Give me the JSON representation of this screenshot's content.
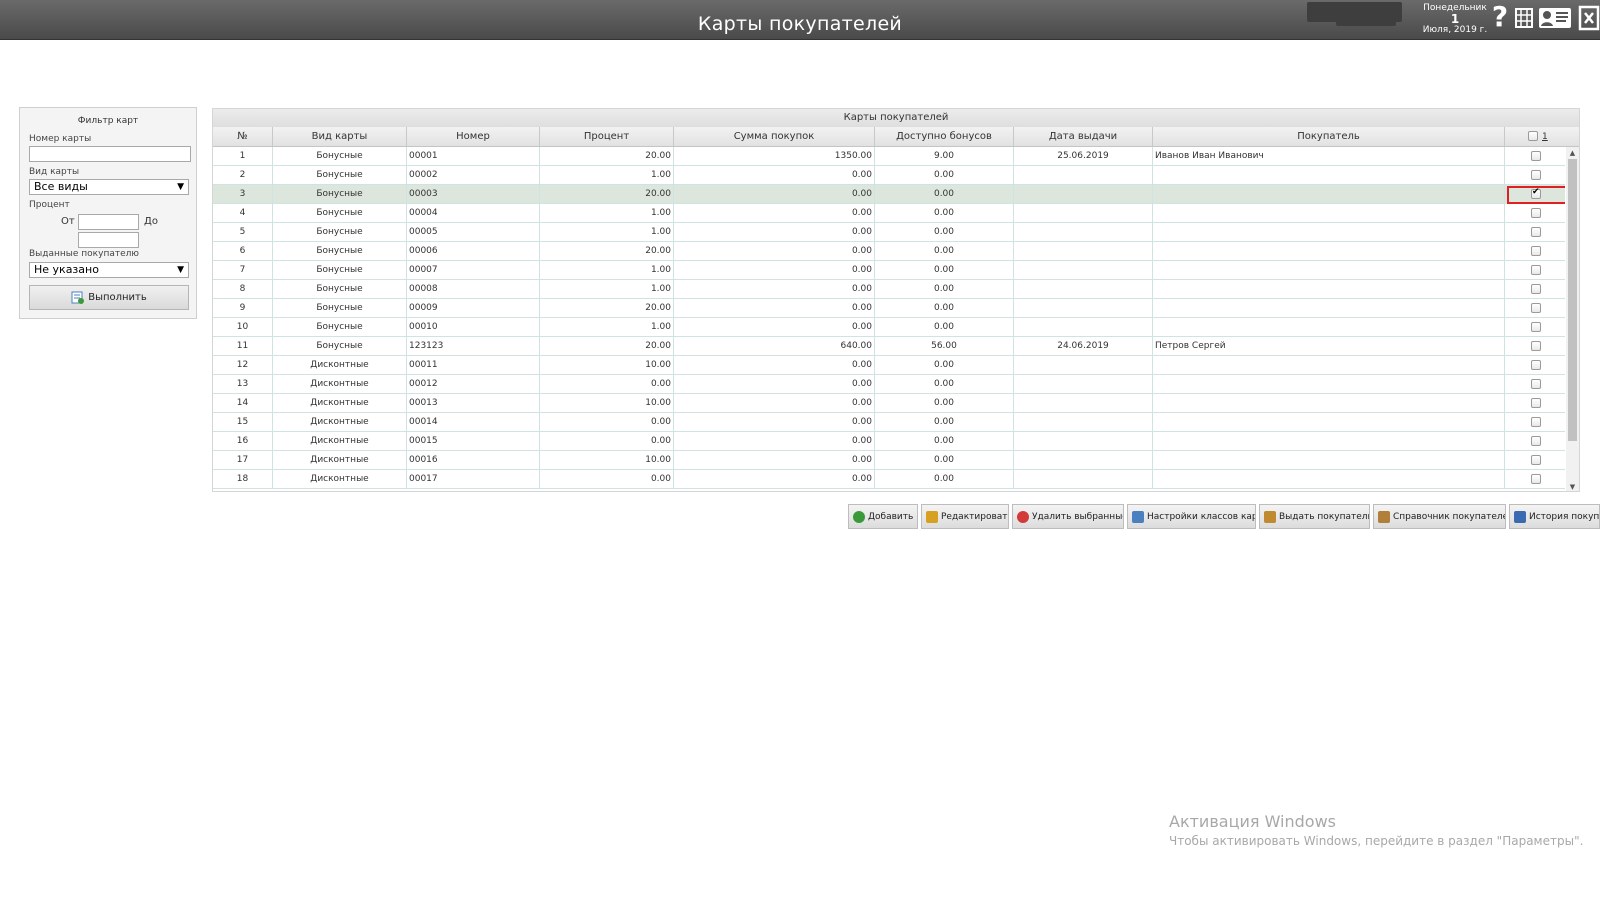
{
  "header": {
    "title": "Карты покупателей",
    "date": {
      "weekday": "Понедельник",
      "day": "1",
      "month_year": "Июля, 2019 г."
    },
    "help_glyph": "?",
    "icons": [
      "help-icon",
      "grid-icon",
      "card-icon",
      "exit-icon"
    ]
  },
  "filter": {
    "title": "Фильтр карт",
    "card_number_label": "Номер карты",
    "card_number_value": "",
    "card_type_label": "Вид карты",
    "card_type_value": "Все виды",
    "percent_label": "Процент",
    "from_label": "От",
    "to_label": "До",
    "issued_label": "Выданные покупателю",
    "issued_value": "Не указано",
    "run_button": "Выполнить"
  },
  "grid": {
    "caption": "Карты покупателей",
    "columns": [
      "№",
      "Вид карты",
      "Номер",
      "Процент",
      "Сумма покупок",
      "Доступно бонусов",
      "Дата выдачи",
      "Покупатель"
    ],
    "select_all_count": "1",
    "rows": [
      {
        "n": "1",
        "type": "Бонусные",
        "number": "00001",
        "percent": "20.00",
        "sum": "1350.00",
        "bonus": "9.00",
        "date": "25.06.2019",
        "customer": "Иванов Иван Иванович",
        "checked": false
      },
      {
        "n": "2",
        "type": "Бонусные",
        "number": "00002",
        "percent": "1.00",
        "sum": "0.00",
        "bonus": "0.00",
        "date": "",
        "customer": "",
        "checked": false
      },
      {
        "n": "3",
        "type": "Бонусные",
        "number": "00003",
        "percent": "20.00",
        "sum": "0.00",
        "bonus": "0.00",
        "date": "",
        "customer": "",
        "checked": true
      },
      {
        "n": "4",
        "type": "Бонусные",
        "number": "00004",
        "percent": "1.00",
        "sum": "0.00",
        "bonus": "0.00",
        "date": "",
        "customer": "",
        "checked": false
      },
      {
        "n": "5",
        "type": "Бонусные",
        "number": "00005",
        "percent": "1.00",
        "sum": "0.00",
        "bonus": "0.00",
        "date": "",
        "customer": "",
        "checked": false
      },
      {
        "n": "6",
        "type": "Бонусные",
        "number": "00006",
        "percent": "20.00",
        "sum": "0.00",
        "bonus": "0.00",
        "date": "",
        "customer": "",
        "checked": false
      },
      {
        "n": "7",
        "type": "Бонусные",
        "number": "00007",
        "percent": "1.00",
        "sum": "0.00",
        "bonus": "0.00",
        "date": "",
        "customer": "",
        "checked": false
      },
      {
        "n": "8",
        "type": "Бонусные",
        "number": "00008",
        "percent": "1.00",
        "sum": "0.00",
        "bonus": "0.00",
        "date": "",
        "customer": "",
        "checked": false
      },
      {
        "n": "9",
        "type": "Бонусные",
        "number": "00009",
        "percent": "20.00",
        "sum": "0.00",
        "bonus": "0.00",
        "date": "",
        "customer": "",
        "checked": false
      },
      {
        "n": "10",
        "type": "Бонусные",
        "number": "00010",
        "percent": "1.00",
        "sum": "0.00",
        "bonus": "0.00",
        "date": "",
        "customer": "",
        "checked": false
      },
      {
        "n": "11",
        "type": "Бонусные",
        "number": "123123",
        "percent": "20.00",
        "sum": "640.00",
        "bonus": "56.00",
        "date": "24.06.2019",
        "customer": "Петров Сергей",
        "checked": false
      },
      {
        "n": "12",
        "type": "Дисконтные",
        "number": "00011",
        "percent": "10.00",
        "sum": "0.00",
        "bonus": "0.00",
        "date": "",
        "customer": "",
        "checked": false
      },
      {
        "n": "13",
        "type": "Дисконтные",
        "number": "00012",
        "percent": "0.00",
        "sum": "0.00",
        "bonus": "0.00",
        "date": "",
        "customer": "",
        "checked": false
      },
      {
        "n": "14",
        "type": "Дисконтные",
        "number": "00013",
        "percent": "10.00",
        "sum": "0.00",
        "bonus": "0.00",
        "date": "",
        "customer": "",
        "checked": false
      },
      {
        "n": "15",
        "type": "Дисконтные",
        "number": "00014",
        "percent": "0.00",
        "sum": "0.00",
        "bonus": "0.00",
        "date": "",
        "customer": "",
        "checked": false
      },
      {
        "n": "16",
        "type": "Дисконтные",
        "number": "00015",
        "percent": "0.00",
        "sum": "0.00",
        "bonus": "0.00",
        "date": "",
        "customer": "",
        "checked": false
      },
      {
        "n": "17",
        "type": "Дисконтные",
        "number": "00016",
        "percent": "10.00",
        "sum": "0.00",
        "bonus": "0.00",
        "date": "",
        "customer": "",
        "checked": false
      },
      {
        "n": "18",
        "type": "Дисконтные",
        "number": "00017",
        "percent": "0.00",
        "sum": "0.00",
        "bonus": "0.00",
        "date": "",
        "customer": "",
        "checked": false
      }
    ]
  },
  "toolbar": {
    "buttons": [
      {
        "label": "Добавить",
        "icon": "add-icon",
        "color": "#3a9a3a"
      },
      {
        "label": "Редактировать",
        "icon": "edit-icon",
        "color": "#d8a020"
      },
      {
        "label": "Удалить выбранные",
        "icon": "delete-icon",
        "color": "#d23a3a"
      },
      {
        "label": "Настройки классов карт",
        "icon": "settings-table-icon",
        "color": "#4a7fc0"
      },
      {
        "label": "Выдать покупателю",
        "icon": "issue-card-icon",
        "color": "#c08a30"
      },
      {
        "label": "Справочник покупателей",
        "icon": "customers-book-icon",
        "color": "#b0803a"
      },
      {
        "label": "История покупок",
        "icon": "history-icon",
        "color": "#3a6ab0"
      }
    ]
  },
  "watermark": {
    "title": "Активация Windows",
    "text": "Чтобы активировать Windows, перейдите в раздел \"Параметры\"."
  }
}
